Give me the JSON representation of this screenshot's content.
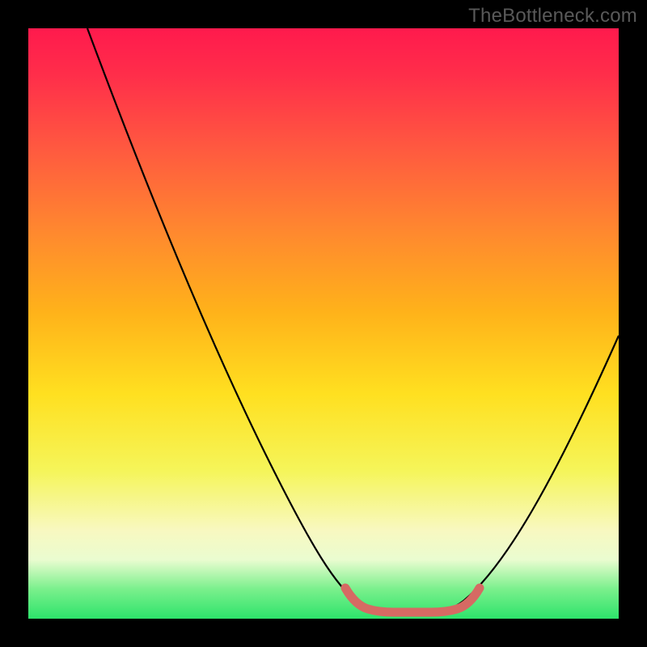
{
  "watermark": "TheBottleneck.com",
  "chart_data": {
    "type": "line",
    "title": "",
    "xlabel": "",
    "ylabel": "",
    "xlim": [
      0,
      100
    ],
    "ylim": [
      0,
      100
    ],
    "series": [
      {
        "name": "bottleneck-curve",
        "x": [
          10,
          15,
          20,
          25,
          30,
          35,
          40,
          45,
          50,
          54,
          58,
          62,
          66,
          70,
          75,
          80,
          85,
          90,
          95,
          100
        ],
        "values": [
          100,
          91,
          82,
          73,
          64,
          55,
          46,
          37,
          27,
          17,
          8,
          3,
          2,
          3,
          8,
          17,
          27,
          37,
          46,
          55
        ]
      },
      {
        "name": "highlight-band",
        "x": [
          56,
          58,
          60,
          62,
          64,
          66,
          68,
          70,
          72
        ],
        "values": [
          5,
          3,
          2.5,
          2,
          2,
          2,
          2.5,
          3,
          5
        ]
      }
    ],
    "colors": {
      "curve": "#000000",
      "highlight": "#d66a63",
      "gradient_top": "#ff1a4d",
      "gradient_mid": "#ffe020",
      "gradient_bottom": "#2de36b"
    }
  }
}
